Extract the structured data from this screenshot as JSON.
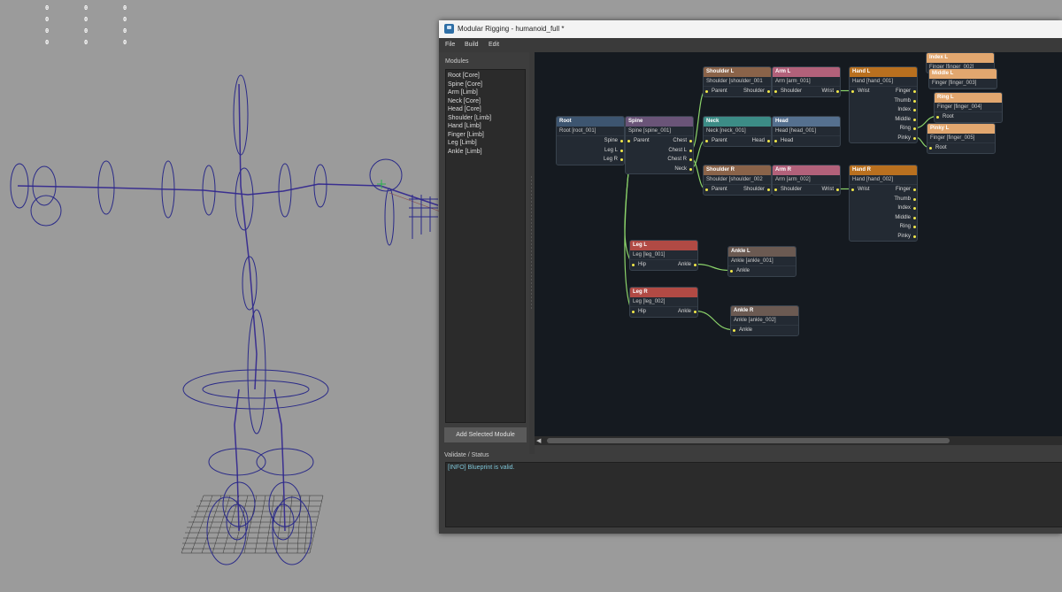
{
  "viewport": {
    "stats": [
      [
        "0",
        "0",
        "0"
      ],
      [
        "0",
        "0",
        "0"
      ],
      [
        "0",
        "0",
        "0"
      ],
      [
        "0",
        "0",
        "0"
      ]
    ]
  },
  "window": {
    "title": "Modular Rigging - humanoid_full *",
    "menu": [
      "File",
      "Build",
      "Edit"
    ],
    "modules_label": "Modules",
    "modules": [
      "Root  [Core]",
      "Spine  [Core]",
      "Arm  [Limb]",
      "Neck  [Core]",
      "Head  [Core]",
      "Shoulder  [Limb]",
      "Hand  [Limb]",
      "Finger  [Limb]",
      "Leg  [Limb]",
      "Ankle  [Limb]"
    ],
    "add_button": "Add Selected Module",
    "status_label": "Validate / Status",
    "status_message": "[INFO] Blueprint is valid."
  },
  "colors": {
    "core": "#3d5570",
    "spine": "#6a5478",
    "shoulder": "#8a6349",
    "arm": "#b2617a",
    "neck": "#3c8c86",
    "head": "#55708f",
    "hand": "#b9701f",
    "finger": "#e2a76f",
    "leg": "#b14a44",
    "ankle": "#6b5a52",
    "wire": "#8bd36a",
    "pin": "#f1e84a"
  },
  "nodes": [
    {
      "id": "root",
      "title": "Root",
      "sub": "Root  [root_001]",
      "color": "core",
      "rows": [
        [
          "",
          "Spine"
        ],
        [
          "",
          "Leg L"
        ],
        [
          "",
          "Leg R"
        ]
      ]
    },
    {
      "id": "spine",
      "title": "Spine",
      "sub": "Spine  [spine_001]",
      "color": "spine",
      "rows": [
        [
          "Parent",
          "Chest"
        ],
        [
          "",
          "Chest L"
        ],
        [
          "",
          "Chest R"
        ],
        [
          "",
          "Neck"
        ]
      ]
    },
    {
      "id": "shoulder_l",
      "title": "Shoulder L",
      "sub": "Shoulder  [shoulder_001",
      "color": "shoulder",
      "rows": [
        [
          "Parent",
          "Shoulder"
        ]
      ]
    },
    {
      "id": "arm_l",
      "title": "Arm L",
      "sub": "Arm  [arm_001]",
      "color": "arm",
      "rows": [
        [
          "Shoulder",
          "Wrist"
        ]
      ]
    },
    {
      "id": "hand_l",
      "title": "Hand L",
      "sub": "Hand  [hand_001]",
      "color": "hand",
      "rows": [
        [
          "Wrist",
          "Finger"
        ],
        [
          "",
          "Thumb"
        ],
        [
          "",
          "Index"
        ],
        [
          "",
          "Middle"
        ],
        [
          "",
          "Ring"
        ],
        [
          "",
          "Pinky"
        ]
      ]
    },
    {
      "id": "index_l",
      "title": "Index L",
      "sub": "Finger  [finger_002]",
      "color": "finger",
      "rows": []
    },
    {
      "id": "middle_l",
      "title": "Middle L",
      "sub": "Finger  [finger_003]",
      "color": "finger",
      "rows": []
    },
    {
      "id": "ring_l",
      "title": "Ring L",
      "sub": "Finger  [finger_004]",
      "color": "finger",
      "rows": [
        [
          "Root",
          ""
        ]
      ]
    },
    {
      "id": "pinky_l",
      "title": "Pinky L",
      "sub": "Finger  [finger_005]",
      "color": "finger",
      "rows": [
        [
          "Root",
          ""
        ]
      ]
    },
    {
      "id": "neck",
      "title": "Neck",
      "sub": "Neck  [neck_001]",
      "color": "neck",
      "rows": [
        [
          "Parent",
          "Head"
        ]
      ]
    },
    {
      "id": "head",
      "title": "Head",
      "sub": "Head  [head_001]",
      "color": "head",
      "rows": [
        [
          "Head",
          ""
        ]
      ]
    },
    {
      "id": "shoulder_r",
      "title": "Shoulder R",
      "sub": "Shoulder  [shoulder_002",
      "color": "shoulder",
      "rows": [
        [
          "Parent",
          "Shoulder"
        ]
      ]
    },
    {
      "id": "arm_r",
      "title": "Arm R",
      "sub": "Arm  [arm_002]",
      "color": "arm",
      "rows": [
        [
          "Shoulder",
          "Wrist"
        ]
      ]
    },
    {
      "id": "hand_r",
      "title": "Hand R",
      "sub": "Hand  [hand_002]",
      "color": "hand",
      "rows": [
        [
          "Wrist",
          "Finger"
        ],
        [
          "",
          "Thumb"
        ],
        [
          "",
          "Index"
        ],
        [
          "",
          "Middle"
        ],
        [
          "",
          "Ring"
        ],
        [
          "",
          "Pinky"
        ]
      ]
    },
    {
      "id": "leg_l",
      "title": "Leg L",
      "sub": "Leg  [leg_001]",
      "color": "leg",
      "rows": [
        [
          "Hip",
          "Ankle"
        ]
      ]
    },
    {
      "id": "ankle_l",
      "title": "Ankle L",
      "sub": "Ankle  [ankle_001]",
      "color": "ankle",
      "rows": [
        [
          "Ankle",
          ""
        ]
      ]
    },
    {
      "id": "leg_r",
      "title": "Leg R",
      "sub": "Leg  [leg_002]",
      "color": "leg",
      "rows": [
        [
          "Hip",
          "Ankle"
        ]
      ]
    },
    {
      "id": "ankle_r",
      "title": "Ankle R",
      "sub": "Ankle  [ankle_002]",
      "color": "ankle",
      "rows": [
        [
          "Ankle",
          ""
        ]
      ]
    }
  ]
}
